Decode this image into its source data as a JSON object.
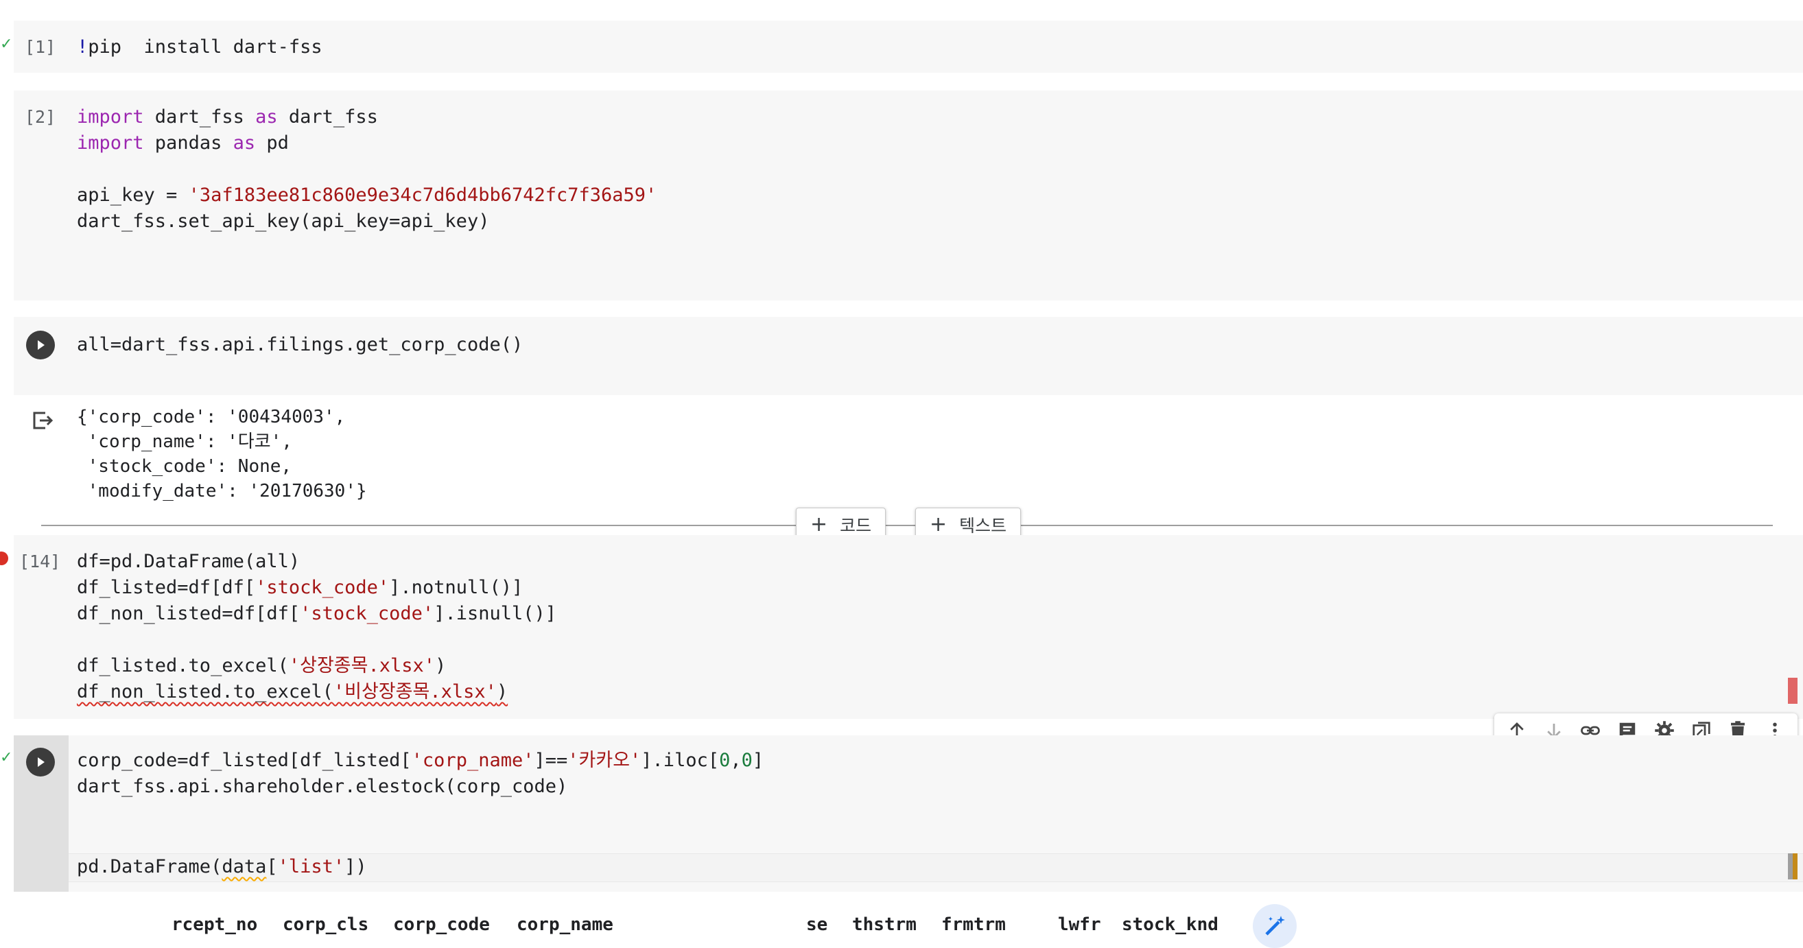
{
  "cells": {
    "c1": {
      "exec": "[1]",
      "bang": "!",
      "code": "pip  install dart-fss"
    },
    "c2": {
      "exec": "[2]",
      "l1_kw": "import",
      "l1_a": " dart_fss ",
      "l1_as": "as",
      "l1_b": " dart_fss",
      "l2_kw": "import",
      "l2_a": " pandas ",
      "l2_as": "as",
      "l2_b": " pd",
      "l4_a": "api_key = ",
      "l4_str": "'3af183ee81c860e9e34c7d6d4bb6742fc7f36a59'",
      "l5": "dart_fss.set_api_key(api_key=api_key)"
    },
    "c3": {
      "code": "all=dart_fss.api.filings.get_corp_code()",
      "output": [
        "{'corp_code': '00434003',",
        " 'corp_name': '다코',",
        " 'stock_code': None,",
        " 'modify_date': '20170630'}"
      ]
    },
    "c4": {
      "exec": "[14]",
      "l1": "df=pd.DataFrame(all)",
      "l2_a": "df_listed=df[df[",
      "l2_str": "'stock_code'",
      "l2_b": "].notnull()]",
      "l3_a": "df_non_listed=df[df[",
      "l3_str": "'stock_code'",
      "l3_b": "].isnull()]",
      "l5_a": "df_listed.to_excel(",
      "l5_str": "'상장종목.xlsx'",
      "l5_b": ")",
      "l6_a": "df_non_listed.to_excel(",
      "l6_str": "'비상장종목.xlsx'",
      "l6_b": ")"
    },
    "c5": {
      "l1_a": "corp_code=df_listed[df_listed[",
      "l1_str1": "'corp_name'",
      "l1_b": "]==",
      "l1_str2": "'카카오'",
      "l1_c": "].iloc[",
      "l1_n1": "0",
      "l1_d": ",",
      "l1_n2": "0",
      "l1_e": "]",
      "l2": "dart_fss.api.shareholder.elestock(corp_code)",
      "l4_a": "pd.DataFrame(",
      "l4_b": "data",
      "l4_c": "[",
      "l4_str": "'list'",
      "l4_d": "])"
    }
  },
  "add_code_label": "코드",
  "add_text_label": "텍스트",
  "table_headers": [
    "rcept_no",
    "corp_cls",
    "corp_code",
    "corp_name",
    "se",
    "thstrm",
    "frmtrm",
    "lwfr",
    "stock_knd"
  ],
  "colors": {
    "keyword": "#9c27b0",
    "string": "#a31515",
    "number": "#1b7c3d",
    "error": "#d93025"
  }
}
